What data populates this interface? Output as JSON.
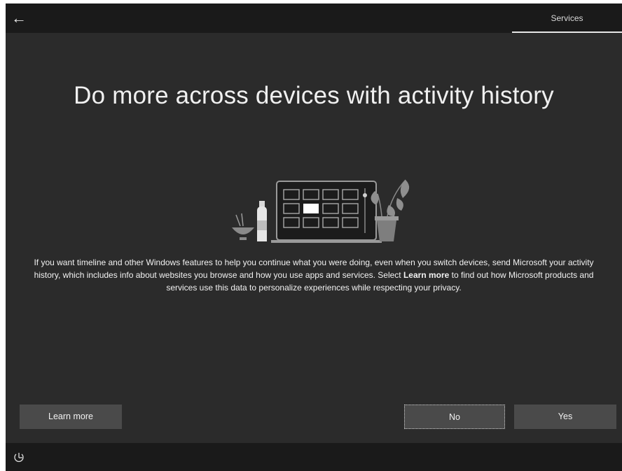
{
  "header": {
    "back_glyph": "←",
    "step_label": "Services"
  },
  "main": {
    "title": "Do more across devices with activity history",
    "description_part1": "If you want timeline and other Windows features to help you continue what you were doing, even when you switch devices, send Microsoft your activity history, which includes info about websites you browse and how you use apps and services. Select ",
    "description_bold": "Learn more",
    "description_part2": " to find out how Microsoft products and services use this data to personalize experiences while respecting your privacy."
  },
  "buttons": {
    "learn_more": "Learn more",
    "no": "No",
    "yes": "Yes"
  },
  "footer": {
    "accessibility_icon": "ease-of-access-icon"
  },
  "colors": {
    "background": "#2b2b2b",
    "bars": "#1a1a1a",
    "button": "#4a4a4a",
    "text": "#f2f2f2"
  }
}
